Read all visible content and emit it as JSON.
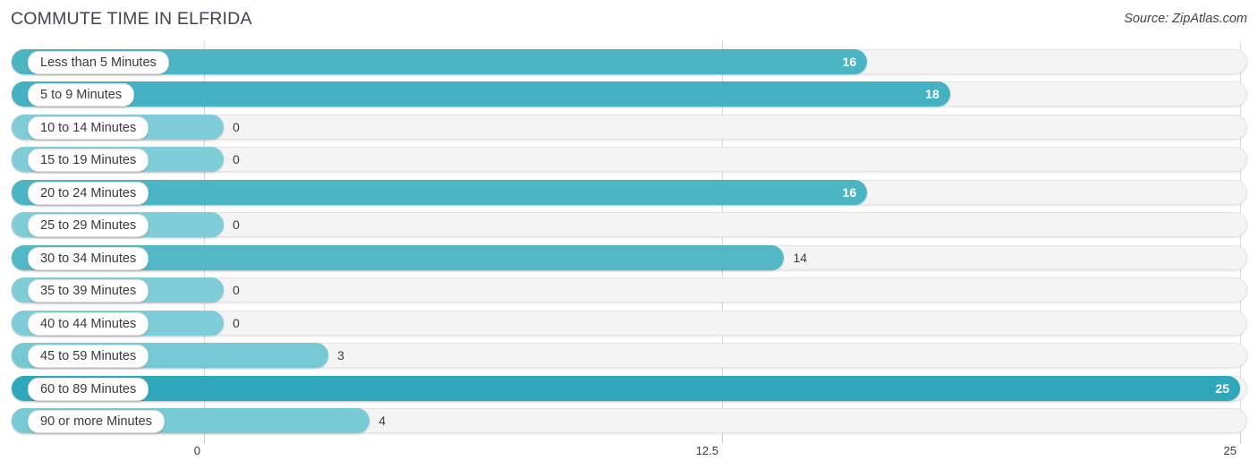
{
  "header": {
    "title": "COMMUTE TIME IN ELFRIDA",
    "source": "Source: ZipAtlas.com"
  },
  "colors": {
    "bar_light": "#7fcdd8",
    "bar_mid": "#76c9d3",
    "bar_strong": "#4cb5c4",
    "bar_dark": "#2fa8bc",
    "track": "#f4f4f4",
    "track_border": "#e3e3e3",
    "gridline": "#d9d9d9",
    "text": "#3a3a3a",
    "value_inside": "#ffffff"
  },
  "axis": {
    "ticks": [
      "0",
      "12.5",
      "25"
    ],
    "tick_values": [
      0,
      12.5,
      25
    ]
  },
  "chart_data": {
    "type": "bar",
    "orientation": "horizontal",
    "title": "COMMUTE TIME IN ELFRIDA",
    "subtitle": "Source: ZipAtlas.com",
    "xlabel": "",
    "ylabel": "",
    "xlim": [
      0,
      25
    ],
    "grid": true,
    "legend": "none",
    "categories": [
      "Less than 5 Minutes",
      "5 to 9 Minutes",
      "10 to 14 Minutes",
      "15 to 19 Minutes",
      "20 to 24 Minutes",
      "25 to 29 Minutes",
      "30 to 34 Minutes",
      "35 to 39 Minutes",
      "40 to 44 Minutes",
      "45 to 59 Minutes",
      "60 to 89 Minutes",
      "90 or more Minutes"
    ],
    "values": [
      16,
      18,
      0,
      0,
      16,
      0,
      14,
      0,
      0,
      3,
      25,
      4
    ],
    "value_labels": [
      "16",
      "18",
      "0",
      "0",
      "16",
      "0",
      "14",
      "0",
      "0",
      "3",
      "25",
      "4"
    ]
  },
  "rows": [
    {
      "label": "Less than 5 Minutes",
      "value": 16,
      "value_label": "16",
      "color": "#4cb5c4",
      "inside": true
    },
    {
      "label": "5 to 9 Minutes",
      "value": 18,
      "value_label": "18",
      "color": "#44b2c2",
      "inside": true
    },
    {
      "label": "10 to 14 Minutes",
      "value": 0,
      "value_label": "0",
      "color": "#7fcdd8",
      "inside": false
    },
    {
      "label": "15 to 19 Minutes",
      "value": 0,
      "value_label": "0",
      "color": "#7fcdd8",
      "inside": false
    },
    {
      "label": "20 to 24 Minutes",
      "value": 16,
      "value_label": "16",
      "color": "#4cb5c4",
      "inside": true
    },
    {
      "label": "25 to 29 Minutes",
      "value": 0,
      "value_label": "0",
      "color": "#7fcdd8",
      "inside": false
    },
    {
      "label": "30 to 34 Minutes",
      "value": 14,
      "value_label": "14",
      "color": "#52b8c6",
      "inside": false
    },
    {
      "label": "35 to 39 Minutes",
      "value": 0,
      "value_label": "0",
      "color": "#7fcdd8",
      "inside": false
    },
    {
      "label": "40 to 44 Minutes",
      "value": 0,
      "value_label": "0",
      "color": "#7fcdd8",
      "inside": false
    },
    {
      "label": "45 to 59 Minutes",
      "value": 3,
      "value_label": "3",
      "color": "#76c9d3",
      "inside": false
    },
    {
      "label": "60 to 89 Minutes",
      "value": 25,
      "value_label": "25",
      "color": "#2fa8bc",
      "inside": true
    },
    {
      "label": "90 or more Minutes",
      "value": 4,
      "value_label": "4",
      "color": "#78cad4",
      "inside": false
    }
  ]
}
